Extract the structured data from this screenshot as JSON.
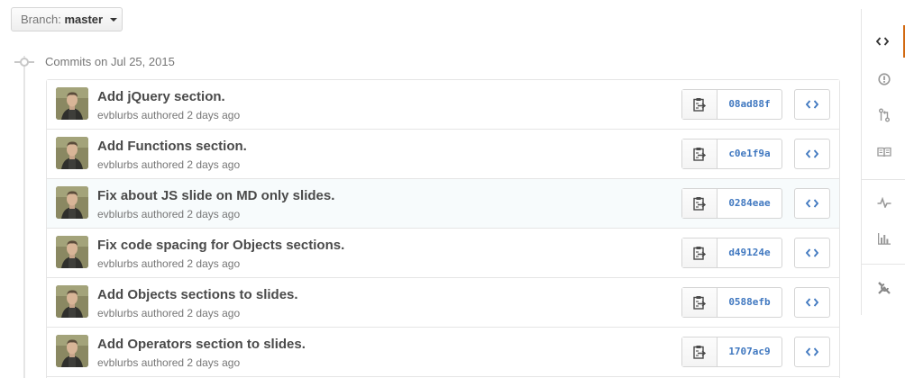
{
  "branch": {
    "label": "Branch:",
    "name": "master"
  },
  "group": {
    "title": "Commits on Jul 25, 2015"
  },
  "commits": [
    {
      "title": "Add jQuery section.",
      "author": "evblurbs",
      "meta": "authored 2 days ago",
      "sha": "08ad88f"
    },
    {
      "title": "Add Functions section.",
      "author": "evblurbs",
      "meta": "authored 2 days ago",
      "sha": "c0e1f9a"
    },
    {
      "title": "Fix about JS slide on MD only slides.",
      "author": "evblurbs",
      "meta": "authored 2 days ago",
      "sha": "0284eae"
    },
    {
      "title": "Fix code spacing for Objects sections.",
      "author": "evblurbs",
      "meta": "authored 2 days ago",
      "sha": "d49124e"
    },
    {
      "title": "Add Objects sections to slides.",
      "author": "evblurbs",
      "meta": "authored 2 days ago",
      "sha": "0588efb"
    },
    {
      "title": "Add Operators section to slides.",
      "author": "evblurbs",
      "meta": "authored 2 days ago",
      "sha": "1707ac9"
    }
  ],
  "sidebar": {
    "items": [
      {
        "icon": "code-icon"
      },
      {
        "icon": "issue-icon"
      },
      {
        "icon": "pull-request-icon"
      },
      {
        "icon": "wiki-book-icon"
      },
      {
        "icon": "pulse-icon"
      },
      {
        "icon": "graph-icon"
      },
      {
        "icon": "settings-tools-icon"
      }
    ]
  },
  "colors": {
    "link": "#4078c0",
    "accent": "#d26911",
    "border": "#e5e5e5"
  }
}
